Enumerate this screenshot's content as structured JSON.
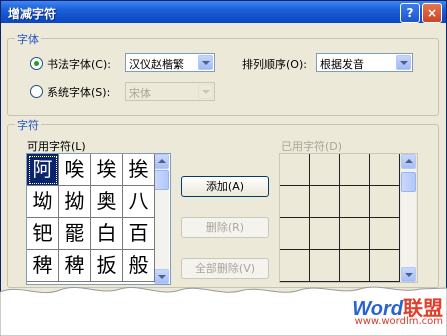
{
  "window": {
    "title": "增减字符",
    "help_symbol": "?",
    "close_symbol": "×"
  },
  "font_group": {
    "label": "字体",
    "calligraphy_radio_label": "书法字体(C):",
    "calligraphy_selected": true,
    "calligraphy_font_value": "汉仪赵楷繁",
    "system_radio_label": "系统字体(S):",
    "system_selected": false,
    "system_font_value": "宋体",
    "sort_label": "排列顺序(O):",
    "sort_value": "根据发音"
  },
  "char_group": {
    "label": "字符",
    "available_label": "可用字符(L)",
    "used_label": "已用字符(D)",
    "available_chars": [
      [
        "阿",
        "唉",
        "埃",
        "挨"
      ],
      [
        "坳",
        "拗",
        "奥",
        "八"
      ],
      [
        "钯",
        "罷",
        "白",
        "百"
      ],
      [
        "稗",
        "稗",
        "扳",
        "般"
      ]
    ],
    "selected_char": "阿",
    "add_button": "添加(A)",
    "delete_button": "删除(R)",
    "delete_all_button": "全部删除(V)"
  },
  "watermark": {
    "word": "Word",
    "union": "联盟",
    "url": "www.wordlm.com"
  },
  "colors": {
    "titlebar": "#0b46c0",
    "dialog_bg": "#ece9d8",
    "group_label": "#2753c7",
    "selection": "#0a246a"
  }
}
